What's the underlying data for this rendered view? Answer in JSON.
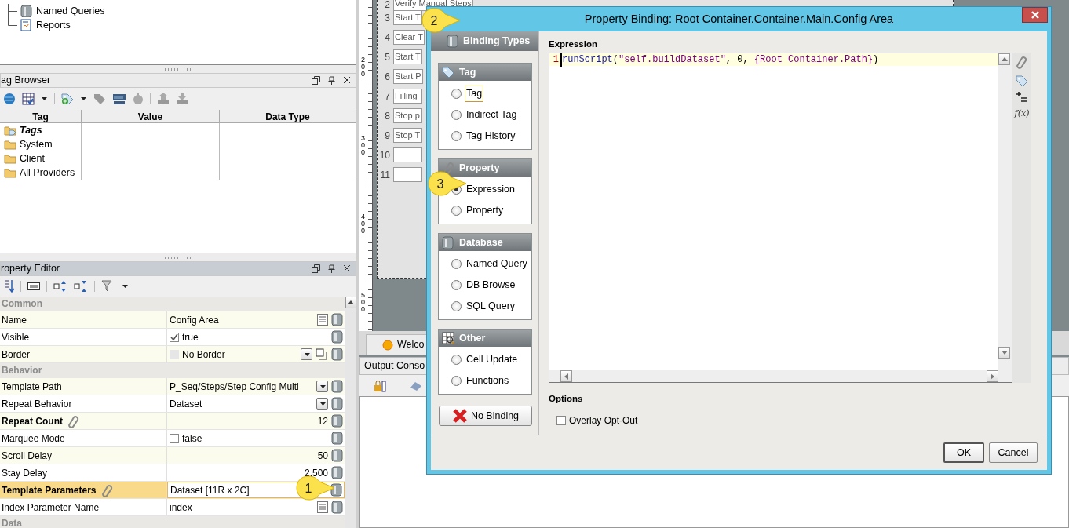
{
  "project_tree": {
    "items": [
      {
        "label": "Named Queries",
        "kind": "query"
      },
      {
        "label": "Reports",
        "kind": "report"
      }
    ]
  },
  "tag_browser": {
    "title": "ag Browser",
    "columns": [
      "Tag",
      "Value",
      "Data Type"
    ],
    "rows": [
      {
        "label": "Tags",
        "bold": true,
        "kind": "tags"
      },
      {
        "label": "System",
        "bold": false,
        "kind": "folder"
      },
      {
        "label": "Client",
        "bold": false,
        "kind": "folder"
      },
      {
        "label": "All Providers",
        "bold": false,
        "kind": "folder"
      }
    ]
  },
  "property_editor": {
    "title": "roperty Editor",
    "sections": [
      {
        "title": "Common",
        "rows": [
          {
            "name": "Name",
            "value": "Config Area",
            "kind": "text",
            "bold": false,
            "bound": false,
            "selected": false
          },
          {
            "name": "Visible",
            "value": "true",
            "kind": "check",
            "checked": true,
            "bold": false,
            "bound": false,
            "selected": false
          },
          {
            "name": "Border",
            "value": "No Border",
            "kind": "border",
            "bold": false,
            "bound": false,
            "selected": false
          }
        ]
      },
      {
        "title": "Behavior",
        "rows": [
          {
            "name": "Template Path",
            "value": "P_Seq/Steps/Step Config Multi",
            "kind": "dropdown",
            "bold": false,
            "bound": false,
            "selected": false
          },
          {
            "name": "Repeat Behavior",
            "value": "Dataset",
            "kind": "dropdown",
            "bold": false,
            "bound": false,
            "selected": false
          },
          {
            "name": "Repeat Count",
            "value": "12",
            "kind": "number",
            "bold": true,
            "bound": true,
            "selected": false
          },
          {
            "name": "Marquee Mode",
            "value": "false",
            "kind": "check",
            "checked": false,
            "bold": false,
            "bound": false,
            "selected": false
          },
          {
            "name": "Scroll Delay",
            "value": "50",
            "kind": "number",
            "bold": false,
            "bound": false,
            "selected": false
          },
          {
            "name": "Stay Delay",
            "value": "2,500",
            "kind": "number",
            "bold": false,
            "bound": false,
            "selected": false
          },
          {
            "name": "Template Parameters",
            "value": "Dataset [11R x 2C]",
            "kind": "dataset",
            "bold": true,
            "bound": true,
            "selected": true
          },
          {
            "name": "Index Parameter Name",
            "value": "index",
            "kind": "text",
            "bold": false,
            "bound": false,
            "selected": false
          }
        ]
      },
      {
        "title": "Data"
      }
    ]
  },
  "designer": {
    "ruler_labels": [
      "200",
      "300",
      "400",
      "500"
    ],
    "rows": [
      {
        "number": "2",
        "text": "Verify Manual Steps"
      },
      {
        "number": "3",
        "text": "Start T"
      },
      {
        "number": "4",
        "text": "Clear T"
      },
      {
        "number": "5",
        "text": "Start T"
      },
      {
        "number": "6",
        "text": "Start P"
      },
      {
        "number": "7",
        "text": "Filling"
      },
      {
        "number": "8",
        "text": "Stop p"
      },
      {
        "number": "9",
        "text": "Stop T"
      },
      {
        "number": "10"
      },
      {
        "number": "11"
      }
    ]
  },
  "welcome_tab": "Welco",
  "output_console": {
    "title": "Output Conso"
  },
  "dialog": {
    "title": "Property Binding: Root Container.Container.Main.Config Area",
    "binding_types_title": "Binding Types",
    "groups": [
      {
        "title": "Tag",
        "kind": "tag",
        "options": [
          {
            "label": "Tag",
            "selected": false,
            "focused": true
          },
          {
            "label": "Indirect Tag",
            "selected": false,
            "focused": false
          },
          {
            "label": "Tag History",
            "selected": false,
            "focused": false
          }
        ]
      },
      {
        "title": "Property",
        "kind": "property",
        "options": [
          {
            "label": "Expression",
            "selected": true,
            "focused": false
          },
          {
            "label": "Property",
            "selected": false,
            "focused": false
          }
        ]
      },
      {
        "title": "Database",
        "kind": "database",
        "options": [
          {
            "label": "Named Query",
            "selected": false,
            "focused": false
          },
          {
            "label": "DB Browse",
            "selected": false,
            "focused": false
          },
          {
            "label": "SQL Query",
            "selected": false,
            "focused": false
          }
        ]
      },
      {
        "title": "Other",
        "kind": "other",
        "options": [
          {
            "label": "Cell Update",
            "selected": false,
            "focused": false
          },
          {
            "label": "Functions",
            "selected": false,
            "focused": false
          }
        ]
      }
    ],
    "no_binding": "No Binding",
    "expression_label": "Expression",
    "code_lines": [
      {
        "number": "1",
        "tokens": [
          {
            "text": "runScript",
            "color": "#1a1aa6"
          },
          {
            "text": "("
          },
          {
            "text": "\"self.buildDataset\"",
            "color": "#800080"
          },
          {
            "text": ", 0, "
          },
          {
            "text": "{Root Container.Path}",
            "color": "#800080"
          },
          {
            "text": ")"
          }
        ]
      }
    ],
    "function_button": "f(x)",
    "options_label": "Options",
    "overlay_opt_out": {
      "label": "Overlay Opt-Out",
      "checked": false
    },
    "buttons": [
      {
        "label": "OK",
        "default": true
      },
      {
        "label": "Cancel",
        "default": false
      }
    ]
  },
  "callouts": [
    "1",
    "2",
    "3"
  ]
}
